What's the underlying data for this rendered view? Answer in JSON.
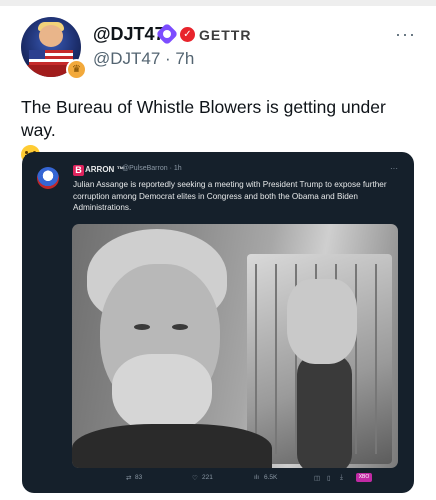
{
  "post": {
    "username": "@DJT47",
    "platform_label": "GETTR",
    "handle_time": "@DJT47 · 7h",
    "more": "···",
    "text": "The Bureau of Whistle Blowers is getting under way."
  },
  "embed": {
    "author_badge": "B",
    "author_name": "ARRON ™",
    "author_handle": "@PulseBarron · 1h",
    "more": "···",
    "text": "Julian Assange is reportedly seeking a meeting with President Trump to expose further corruption among Democrat elites in Congress and both the Obama and Biden Administrations.",
    "actions": {
      "retweets": "83",
      "likes": "221",
      "views": "6.5K",
      "xbo_label": "XBO"
    }
  },
  "icons": {
    "avatar": "profile-avatar",
    "verified": "verified-badge-icon",
    "gettr": "gettr-logo-icon",
    "emoji": "grinning-face-emoji"
  },
  "colors": {
    "embed_bg": "#15202b",
    "handle": "#536471",
    "verified": "#7c4dff",
    "gettr": "#e8242c",
    "xbo": "#c12aa4"
  }
}
